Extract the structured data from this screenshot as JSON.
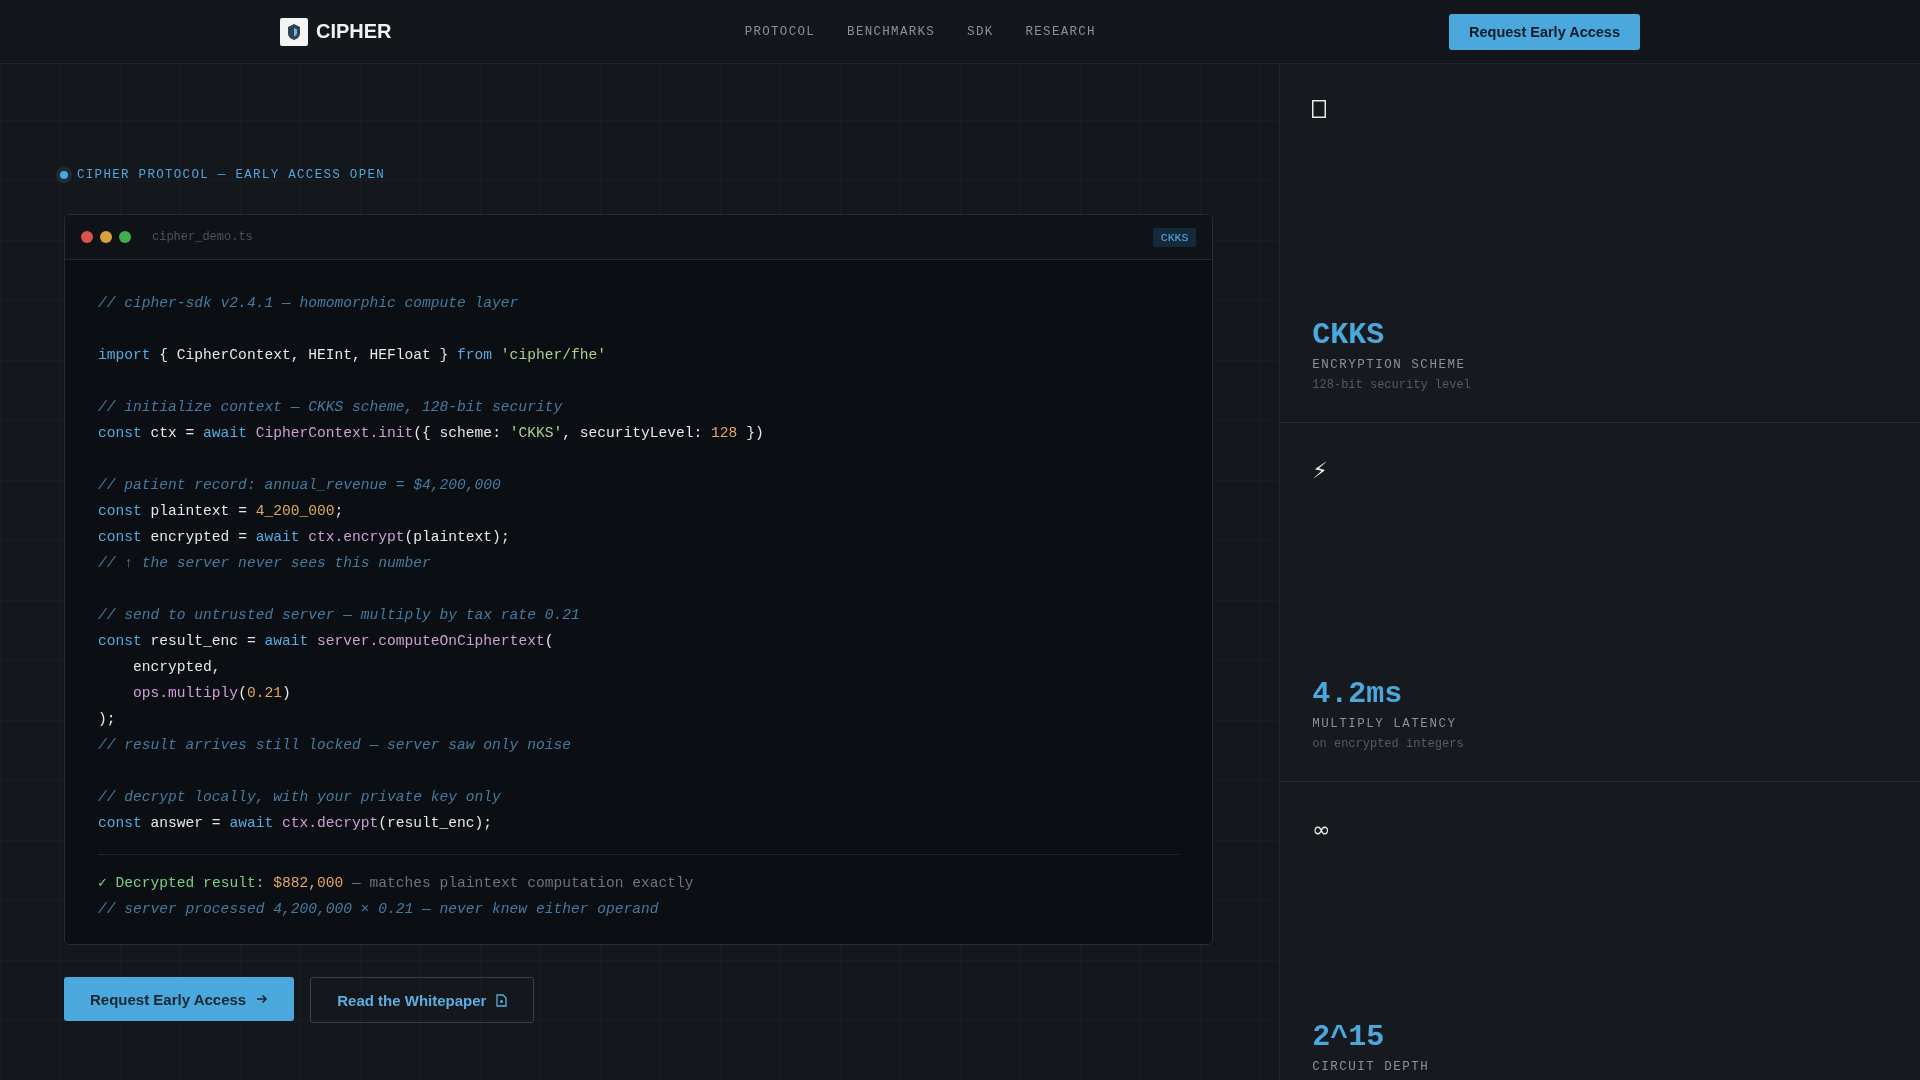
{
  "header": {
    "brand": "CIPHER",
    "nav": [
      "PROTOCOL",
      "BENCHMARKS",
      "SDK",
      "RESEARCH"
    ],
    "cta": "Request Early Access"
  },
  "badge": "CIPHER PROTOCOL — EARLY ACCESS OPEN",
  "code_window": {
    "dots": [
      {
        "color": "#d9534a"
      },
      {
        "color": "#d9a13b"
      },
      {
        "color": "#3fae4f"
      }
    ],
    "filename": "cipher_demo.ts",
    "tag": "CKKS",
    "blocks": [
      [
        [
          {
            "kind": "comment",
            "t": "// cipher-sdk v2.4.1 — homomorphic compute layer"
          }
        ]
      ],
      [
        [
          {
            "kind": "keyword",
            "t": "import"
          },
          {
            "kind": "plain",
            "t": " { CipherContext, HEInt, HEFloat } "
          },
          {
            "kind": "keyword",
            "t": "from"
          },
          {
            "kind": "string",
            "t": " 'cipher/fhe'"
          }
        ]
      ],
      [
        [
          {
            "kind": "comment",
            "t": "// initialize context — CKKS scheme, 128-bit security"
          }
        ],
        [
          {
            "kind": "keyword",
            "t": "const"
          },
          {
            "kind": "plain",
            "t": " ctx = "
          },
          {
            "kind": "keyword",
            "t": "await"
          },
          {
            "kind": "func",
            "t": " CipherContext.init"
          },
          {
            "kind": "plain",
            "t": "({ scheme: "
          },
          {
            "kind": "string",
            "t": "'CKKS'"
          },
          {
            "kind": "plain",
            "t": ", securityLevel: "
          },
          {
            "kind": "number",
            "t": "128"
          },
          {
            "kind": "plain",
            "t": " })"
          }
        ]
      ],
      [
        [
          {
            "kind": "comment",
            "t": "// patient record: annual_revenue = $4,200,000"
          }
        ],
        [
          {
            "kind": "keyword",
            "t": "const"
          },
          {
            "kind": "plain",
            "t": " plaintext = "
          },
          {
            "kind": "number",
            "t": "4_200_000"
          },
          {
            "kind": "plain",
            "t": ";"
          }
        ],
        [
          {
            "kind": "keyword",
            "t": "const"
          },
          {
            "kind": "plain",
            "t": " encrypted = "
          },
          {
            "kind": "keyword",
            "t": "await"
          },
          {
            "kind": "func",
            "t": " ctx.encrypt"
          },
          {
            "kind": "plain",
            "t": "(plaintext);"
          }
        ],
        [
          {
            "kind": "comment",
            "t": "// ↑ the server never sees this number"
          }
        ]
      ],
      [
        [
          {
            "kind": "comment",
            "t": "// send to untrusted server — multiply by tax rate 0.21"
          }
        ],
        [
          {
            "kind": "keyword",
            "t": "const"
          },
          {
            "kind": "plain",
            "t": " result_enc = "
          },
          {
            "kind": "keyword",
            "t": "await"
          },
          {
            "kind": "func",
            "t": " server.computeOnCiphertext"
          },
          {
            "kind": "plain",
            "t": "("
          }
        ],
        [
          {
            "kind": "plain",
            "t": "    encrypted,"
          }
        ],
        [
          {
            "kind": "func",
            "t": "    ops.multiply"
          },
          {
            "kind": "plain",
            "t": "("
          },
          {
            "kind": "number",
            "t": "0.21"
          },
          {
            "kind": "plain",
            "t": ")"
          }
        ],
        [
          {
            "kind": "plain",
            "t": ");"
          }
        ],
        [
          {
            "kind": "comment",
            "t": "// result arrives still locked — server saw only noise"
          }
        ]
      ],
      [
        [
          {
            "kind": "comment",
            "t": "// decrypt locally, with your private key only"
          }
        ],
        [
          {
            "kind": "keyword",
            "t": "const"
          },
          {
            "kind": "plain",
            "t": " answer = "
          },
          {
            "kind": "keyword",
            "t": "await"
          },
          {
            "kind": "func",
            "t": " ctx.decrypt"
          },
          {
            "kind": "plain",
            "t": "(result_enc);"
          }
        ]
      ]
    ],
    "output": [
      [
        {
          "kind": "success",
          "t": "✓ Decrypted result: "
        },
        {
          "kind": "number",
          "t": "$882,000"
        },
        {
          "kind": "muted",
          "t": " — matches plaintext computation exactly"
        }
      ],
      [
        {
          "kind": "comment",
          "t": "// server processed 4,200,000 × 0.21 — never knew either operand"
        }
      ]
    ]
  },
  "actions": [
    {
      "kind": "primary",
      "label": "Request Early Access"
    },
    {
      "kind": "secondary",
      "label": "Read the Whitepaper"
    }
  ],
  "stats": [
    {
      "icon": {
        "kind": "box"
      },
      "value": "CKKS",
      "label": "ENCRYPTION SCHEME",
      "sub": "128-bit security level"
    },
    {
      "icon": {
        "kind": "glyph",
        "text": "⚡"
      },
      "value": "4.2ms",
      "label": "MULTIPLY LATENCY",
      "sub": "on encrypted integers"
    },
    {
      "icon": {
        "kind": "glyph",
        "text": "∞"
      },
      "value": "2^15",
      "label": "CIRCUIT DEPTH"
    }
  ]
}
